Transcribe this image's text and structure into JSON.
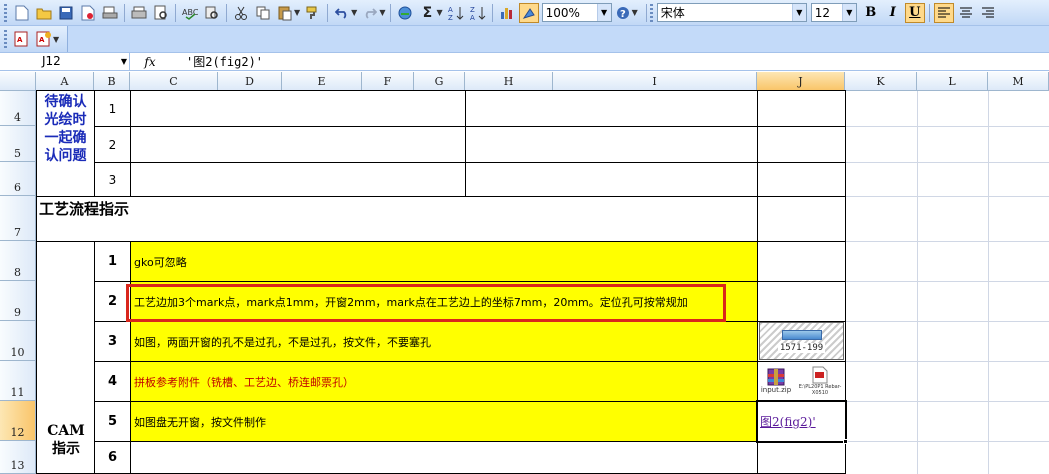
{
  "toolbar": {
    "zoom": "100%",
    "font_name": "宋体",
    "font_size": "12",
    "bold_label": "B",
    "italic_label": "I",
    "underline_label": "U",
    "sum_label": "Σ"
  },
  "formula_bar": {
    "name_box": "J12",
    "fx_label": "fx",
    "content": "'图2(fig2)'"
  },
  "columns": [
    "A",
    "B",
    "C",
    "D",
    "E",
    "F",
    "G",
    "H",
    "I",
    "J",
    "K",
    "L",
    "M"
  ],
  "rows": [
    "4",
    "5",
    "6",
    "7",
    "8",
    "9",
    "10",
    "11",
    "12",
    "13"
  ],
  "cells": {
    "a4": "待确认光绘时一起确认问题",
    "b4": "1",
    "b5": "2",
    "b6": "3",
    "a7": "工艺流程指示",
    "a12": "CAM指示",
    "b8": "1",
    "b9": "2",
    "b10": "3",
    "b11": "4",
    "b12": "5",
    "b13": "6",
    "c8": "gko可忽略",
    "c9": "工艺边加3个mark点，mark点1mm，开窗2mm，mark点在工艺边上的坐标7mm，20mm。定位孔可按常规加",
    "c10": "如图，两面开窗的孔不是过孔，不是过孔，按文件，不要塞孔",
    "c11": "拼板参考附件（铣槽、工艺边、桥连邮票孔）",
    "c12": "如图盘无开窗，按文件制作",
    "j12": "图2(fig2)'"
  },
  "attachments": {
    "j10_label": "1571-199",
    "j11a_label": "input.zip",
    "j11b_label": "E:\\PL20P1 Rebar-X0510"
  }
}
